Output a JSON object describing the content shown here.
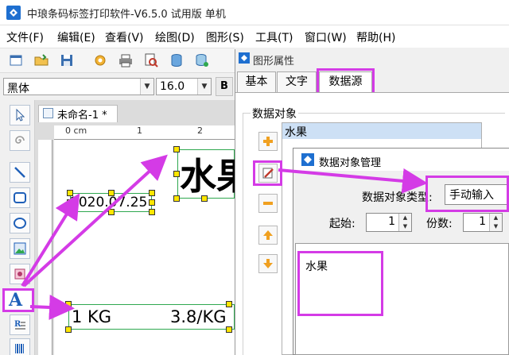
{
  "window": {
    "title": "中琅条码标签打印软件-V6.5.0 试用版 单机"
  },
  "menu": {
    "items": [
      "文件(F)",
      "编辑(E)",
      "查看(V)",
      "绘图(D)",
      "图形(S)",
      "工具(T)",
      "窗口(W)",
      "帮助(H)"
    ]
  },
  "toolbar": {
    "icons": [
      "new-icon",
      "open-icon",
      "save-icon",
      "settings-gear-icon",
      "print-icon",
      "print-preview-icon",
      "database-icon",
      "database-settings-icon"
    ]
  },
  "fontbar": {
    "font_name": "黑体",
    "font_size": "16.0",
    "bold_label": "B"
  },
  "tools": {
    "icons": [
      "pointer-icon",
      "spiral-icon",
      "line-icon",
      "rounded-rect-icon",
      "ellipse-icon",
      "image-icon",
      "text-icon",
      "rich-text-icon",
      "barcode-icon"
    ],
    "text_glyph": "A"
  },
  "document": {
    "tab_label": "未命名-1 *",
    "ruler_unit": "0 cm",
    "ruler_marks": [
      "1",
      "2"
    ],
    "labels": {
      "title": "水果",
      "date": "2020.07.25",
      "weight": "1 KG",
      "price": "3.8/KG"
    }
  },
  "dialog": {
    "title": "图形属性",
    "tabs": [
      "基本",
      "文字",
      "数据源"
    ],
    "active_tab": "数据源",
    "group_label": "数据对象",
    "list_items": [
      "水果"
    ]
  },
  "subdialog": {
    "title": "数据对象管理",
    "type_label": "数据对象类型:",
    "type_value": "手动输入",
    "start_label": "起始:",
    "start_value": "1",
    "copies_label": "份数:",
    "copies_value": "1",
    "content_value": "水果"
  },
  "colors": {
    "highlight": "#d43be6",
    "selection_frame": "#2fa84f",
    "handle": "#ffe600",
    "list_selected": "#cde0f5"
  }
}
